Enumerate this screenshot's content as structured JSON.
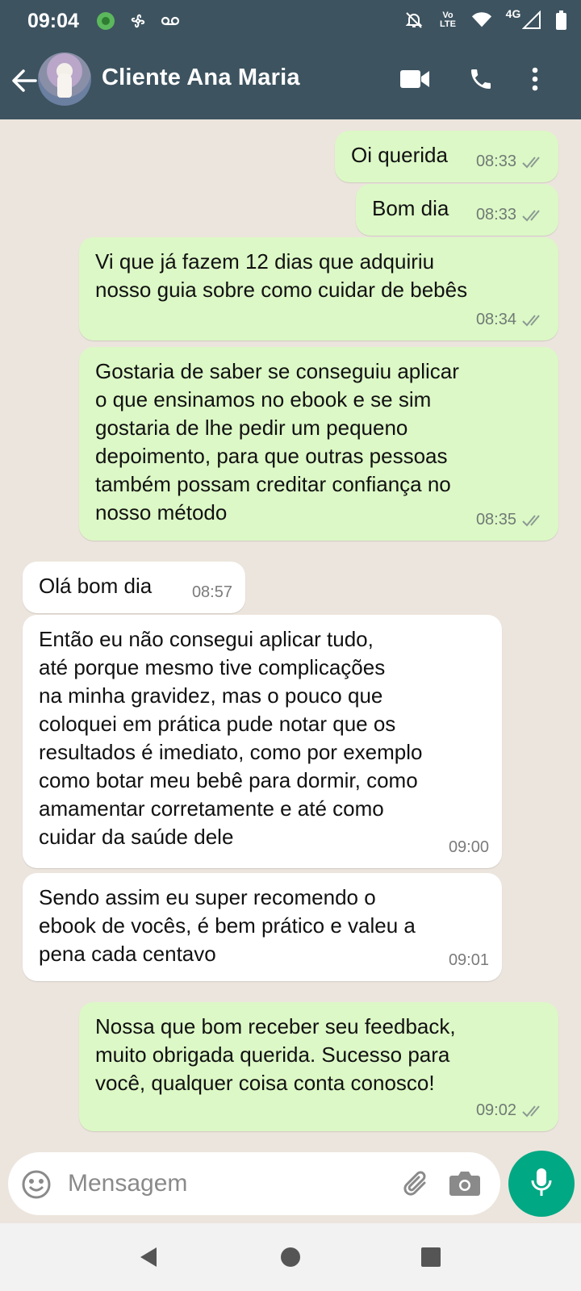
{
  "status_bar": {
    "time": "09:04",
    "network_label_top": "Vo",
    "network_label_bottom": "LTE",
    "signal_label": "4G"
  },
  "header": {
    "contact_name": "Cliente Ana Maria"
  },
  "messages": [
    {
      "direction": "out",
      "text": "Oi querida",
      "time": "08:33"
    },
    {
      "direction": "out",
      "text": "Bom dia",
      "time": "08:33"
    },
    {
      "direction": "out",
      "text": "Vi que já fazem 12 dias que adquiriu\nnosso guia sobre como cuidar de bebês",
      "time": "08:34"
    },
    {
      "direction": "out",
      "text": "Gostaria de saber se conseguiu aplicar\no que ensinamos no ebook e se sim\ngostaria de lhe pedir um pequeno\ndepoimento, para que outras pessoas\ntambém possam creditar confiança no\nnosso método",
      "time": "08:35"
    },
    {
      "direction": "in",
      "text": "Olá bom dia",
      "time": "08:57"
    },
    {
      "direction": "in",
      "text": "Então eu não consegui aplicar tudo,\naté porque mesmo tive complicações\nna minha gravidez, mas o pouco que\ncoloquei em prática pude notar que os\nresultados é imediato, como por exemplo\ncomo botar meu bebê para dormir, como\namamentar corretamente e até como\ncuidar da saúde dele",
      "time": "09:00"
    },
    {
      "direction": "in",
      "text": "Sendo assim eu super recomendo o\nebook de vocês, é bem prático e valeu a\npena cada centavo",
      "time": "09:01"
    },
    {
      "direction": "out",
      "text": "Nossa que bom receber seu feedback,\nmuito obrigada querida. Sucesso para\nvocê, qualquer coisa conta conosco!",
      "time": "09:02"
    }
  ],
  "input": {
    "placeholder": "Mensagem",
    "value": ""
  },
  "colors": {
    "header": "#3d5360",
    "outgoing_bubble": "#dcf8c6",
    "incoming_bubble": "#ffffff",
    "chat_background": "#ece5dd",
    "mic_button": "#00a884"
  }
}
